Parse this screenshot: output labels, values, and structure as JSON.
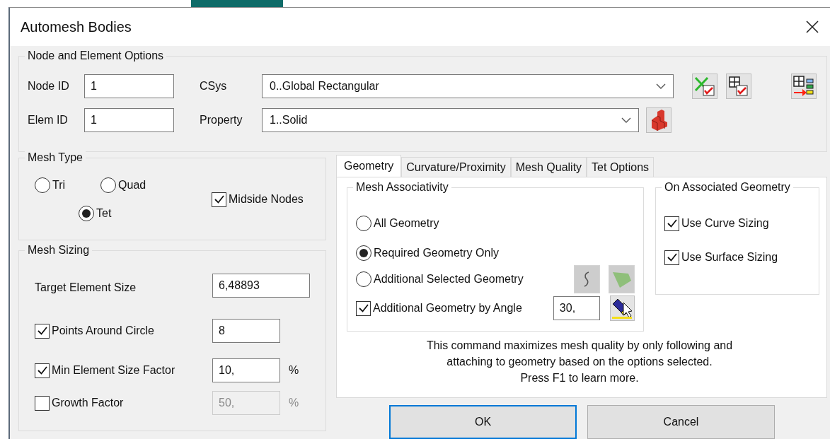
{
  "window": {
    "title": "Automesh Bodies"
  },
  "node_element_options": {
    "title": "Node and Element Options",
    "node_id": {
      "label": "Node ID",
      "value": "1"
    },
    "elem_id": {
      "label": "Elem ID",
      "value": "1"
    },
    "csys": {
      "label": "CSys",
      "value": "0..Global Rectangular"
    },
    "property": {
      "label": "Property",
      "value": "1..Solid"
    }
  },
  "mesh_type": {
    "title": "Mesh Type",
    "options": [
      {
        "label": "Tri",
        "selected": false
      },
      {
        "label": "Quad",
        "selected": false
      },
      {
        "label": "Tet",
        "selected": true
      }
    ],
    "midside_nodes": {
      "label": "Midside Nodes",
      "checked": true
    }
  },
  "mesh_sizing": {
    "title": "Mesh Sizing",
    "rows": [
      {
        "kind": "plain",
        "label": "Target Element Size",
        "value": "6,48893"
      },
      {
        "kind": "check",
        "label": "Points Around Circle",
        "checked": true,
        "value": "8"
      },
      {
        "kind": "check",
        "label": "Min Element Size Factor",
        "checked": true,
        "value": "10,",
        "unit": "%"
      },
      {
        "kind": "check",
        "label": "Growth Factor",
        "checked": false,
        "disabled": true,
        "value": "50,",
        "unit": "%"
      }
    ]
  },
  "tabs": [
    {
      "label": "Geometry",
      "selected": true
    },
    {
      "label": "Curvature/Proximity",
      "selected": false
    },
    {
      "label": "Mesh Quality",
      "selected": false
    },
    {
      "label": "Tet Options",
      "selected": false
    }
  ],
  "geometry": {
    "mesh_associativity": {
      "title": "Mesh Associativity",
      "options": [
        {
          "kind": "radio",
          "label": "All Geometry",
          "selected": false
        },
        {
          "kind": "radio",
          "label": "Required Geometry Only",
          "selected": true
        },
        {
          "kind": "radio",
          "label": "Additional Selected Geometry",
          "selected": false
        },
        {
          "kind": "check",
          "label": "Additional Geometry by Angle",
          "checked": true,
          "value": "30,"
        }
      ]
    },
    "on_associated_geometry": {
      "title": "On Associated Geometry",
      "options": [
        {
          "label": "Use Curve Sizing",
          "checked": true
        },
        {
          "label": "Use Surface Sizing",
          "checked": true
        }
      ]
    },
    "note": "This command maximizes mesh quality by only following and\nattaching to geometry based on the options selected.\nPress F1 to learn more."
  },
  "buttons": [
    {
      "label": "OK",
      "default": true
    },
    {
      "label": "Cancel",
      "default": false
    }
  ]
}
